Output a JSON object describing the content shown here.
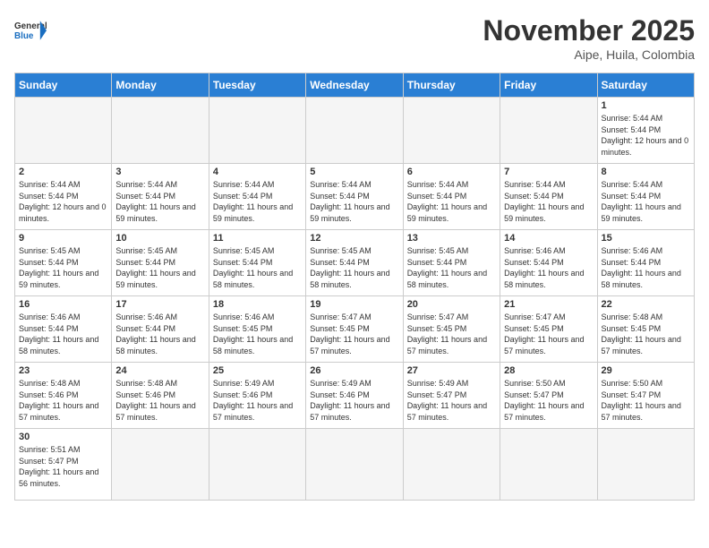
{
  "header": {
    "logo_general": "General",
    "logo_blue": "Blue",
    "month_title": "November 2025",
    "location": "Aipe, Huila, Colombia"
  },
  "weekdays": [
    "Sunday",
    "Monday",
    "Tuesday",
    "Wednesday",
    "Thursday",
    "Friday",
    "Saturday"
  ],
  "days": [
    {
      "num": "",
      "empty": true
    },
    {
      "num": "",
      "empty": true
    },
    {
      "num": "",
      "empty": true
    },
    {
      "num": "",
      "empty": true
    },
    {
      "num": "",
      "empty": true
    },
    {
      "num": "",
      "empty": true
    },
    {
      "num": "1",
      "sunrise": "5:44 AM",
      "sunset": "5:44 PM",
      "daylight": "12 hours and 0 minutes."
    },
    {
      "num": "2",
      "sunrise": "5:44 AM",
      "sunset": "5:44 PM",
      "daylight": "12 hours and 0 minutes."
    },
    {
      "num": "3",
      "sunrise": "5:44 AM",
      "sunset": "5:44 PM",
      "daylight": "11 hours and 59 minutes."
    },
    {
      "num": "4",
      "sunrise": "5:44 AM",
      "sunset": "5:44 PM",
      "daylight": "11 hours and 59 minutes."
    },
    {
      "num": "5",
      "sunrise": "5:44 AM",
      "sunset": "5:44 PM",
      "daylight": "11 hours and 59 minutes."
    },
    {
      "num": "6",
      "sunrise": "5:44 AM",
      "sunset": "5:44 PM",
      "daylight": "11 hours and 59 minutes."
    },
    {
      "num": "7",
      "sunrise": "5:44 AM",
      "sunset": "5:44 PM",
      "daylight": "11 hours and 59 minutes."
    },
    {
      "num": "8",
      "sunrise": "5:44 AM",
      "sunset": "5:44 PM",
      "daylight": "11 hours and 59 minutes."
    },
    {
      "num": "9",
      "sunrise": "5:45 AM",
      "sunset": "5:44 PM",
      "daylight": "11 hours and 59 minutes."
    },
    {
      "num": "10",
      "sunrise": "5:45 AM",
      "sunset": "5:44 PM",
      "daylight": "11 hours and 59 minutes."
    },
    {
      "num": "11",
      "sunrise": "5:45 AM",
      "sunset": "5:44 PM",
      "daylight": "11 hours and 58 minutes."
    },
    {
      "num": "12",
      "sunrise": "5:45 AM",
      "sunset": "5:44 PM",
      "daylight": "11 hours and 58 minutes."
    },
    {
      "num": "13",
      "sunrise": "5:45 AM",
      "sunset": "5:44 PM",
      "daylight": "11 hours and 58 minutes."
    },
    {
      "num": "14",
      "sunrise": "5:46 AM",
      "sunset": "5:44 PM",
      "daylight": "11 hours and 58 minutes."
    },
    {
      "num": "15",
      "sunrise": "5:46 AM",
      "sunset": "5:44 PM",
      "daylight": "11 hours and 58 minutes."
    },
    {
      "num": "16",
      "sunrise": "5:46 AM",
      "sunset": "5:44 PM",
      "daylight": "11 hours and 58 minutes."
    },
    {
      "num": "17",
      "sunrise": "5:46 AM",
      "sunset": "5:44 PM",
      "daylight": "11 hours and 58 minutes."
    },
    {
      "num": "18",
      "sunrise": "5:46 AM",
      "sunset": "5:45 PM",
      "daylight": "11 hours and 58 minutes."
    },
    {
      "num": "19",
      "sunrise": "5:47 AM",
      "sunset": "5:45 PM",
      "daylight": "11 hours and 57 minutes."
    },
    {
      "num": "20",
      "sunrise": "5:47 AM",
      "sunset": "5:45 PM",
      "daylight": "11 hours and 57 minutes."
    },
    {
      "num": "21",
      "sunrise": "5:47 AM",
      "sunset": "5:45 PM",
      "daylight": "11 hours and 57 minutes."
    },
    {
      "num": "22",
      "sunrise": "5:48 AM",
      "sunset": "5:45 PM",
      "daylight": "11 hours and 57 minutes."
    },
    {
      "num": "23",
      "sunrise": "5:48 AM",
      "sunset": "5:46 PM",
      "daylight": "11 hours and 57 minutes."
    },
    {
      "num": "24",
      "sunrise": "5:48 AM",
      "sunset": "5:46 PM",
      "daylight": "11 hours and 57 minutes."
    },
    {
      "num": "25",
      "sunrise": "5:49 AM",
      "sunset": "5:46 PM",
      "daylight": "11 hours and 57 minutes."
    },
    {
      "num": "26",
      "sunrise": "5:49 AM",
      "sunset": "5:46 PM",
      "daylight": "11 hours and 57 minutes."
    },
    {
      "num": "27",
      "sunrise": "5:49 AM",
      "sunset": "5:47 PM",
      "daylight": "11 hours and 57 minutes."
    },
    {
      "num": "28",
      "sunrise": "5:50 AM",
      "sunset": "5:47 PM",
      "daylight": "11 hours and 57 minutes."
    },
    {
      "num": "29",
      "sunrise": "5:50 AM",
      "sunset": "5:47 PM",
      "daylight": "11 hours and 57 minutes."
    },
    {
      "num": "30",
      "sunrise": "5:51 AM",
      "sunset": "5:47 PM",
      "daylight": "11 hours and 56 minutes."
    },
    {
      "num": "",
      "empty": true
    },
    {
      "num": "",
      "empty": true
    },
    {
      "num": "",
      "empty": true
    },
    {
      "num": "",
      "empty": true
    },
    {
      "num": "",
      "empty": true
    },
    {
      "num": "",
      "empty": true
    }
  ],
  "labels": {
    "sunrise": "Sunrise:",
    "sunset": "Sunset:",
    "daylight": "Daylight:"
  }
}
